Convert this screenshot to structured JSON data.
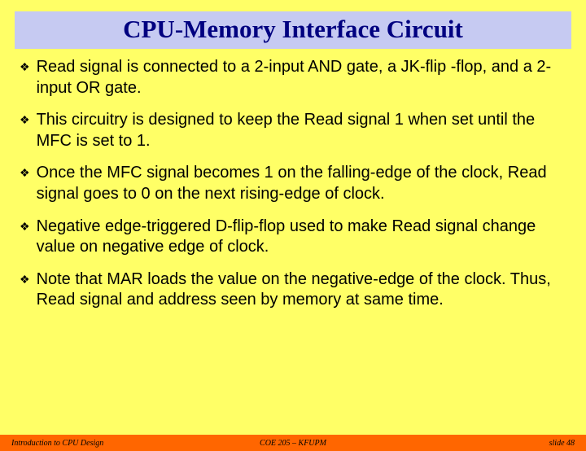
{
  "title": "CPU-Memory Interface Circuit",
  "bullets": [
    "Read signal is connected to a 2-input AND gate, a JK-flip -flop, and a 2-input OR gate.",
    "This circuitry is designed to keep the Read signal 1 when set until the MFC is set to 1.",
    "Once the MFC signal becomes 1 on the falling-edge of the clock, Read signal goes to 0 on the next rising-edge of clock.",
    "Negative edge-triggered D-flip-flop used to make Read signal change value on negative edge of clock.",
    "Note that MAR loads the value on the negative-edge of the clock. Thus, Read signal and address seen by memory at same time."
  ],
  "footer": {
    "left": "Introduction to CPU Design",
    "center": "COE 205 – KFUPM",
    "right": "slide 48"
  }
}
